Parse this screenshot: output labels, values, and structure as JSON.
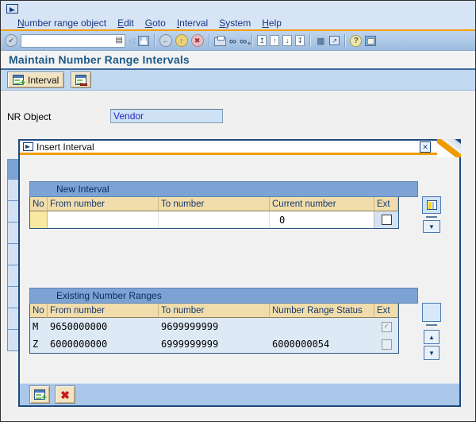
{
  "window": {
    "app_icon": "sap-logo-icon"
  },
  "menu": {
    "items": [
      "Number range object",
      "Edit",
      "Goto",
      "Interval",
      "System",
      "Help"
    ]
  },
  "toolbar": {
    "command_field": {
      "value": "",
      "placeholder": ""
    },
    "icons": {
      "enter": "✔",
      "collapse": "◁",
      "back_circle": "←",
      "exit_circle": "↑",
      "cancel_circle": "✖",
      "find": "∞",
      "find_next": "∞",
      "first_page": "↥",
      "prev_page": "↑",
      "next_page": "↓",
      "last_page": "↧",
      "new_session": "▦",
      "shortcut": "↗",
      "help": "?"
    }
  },
  "header": {
    "title": "Maintain Number Range Intervals"
  },
  "app_toolbar": {
    "interval_label": "Interval"
  },
  "form": {
    "nr_object_label": "NR Object",
    "nr_object_value": "Vendor"
  },
  "dialog": {
    "title": "Insert Interval",
    "close": "✕",
    "new_interval": {
      "section_title": "New Interval",
      "columns": [
        "No",
        "From number",
        "To number",
        "Current number",
        "Ext"
      ],
      "row": {
        "no": "",
        "from": "",
        "to": "",
        "current": "0",
        "ext": false
      }
    },
    "existing": {
      "section_title": "Existing Number Ranges",
      "columns": [
        "No",
        "From number",
        "To number",
        "Number Range Status",
        "Ext"
      ],
      "rows": [
        {
          "no": "M",
          "from": "9650000000",
          "to": "9699999999",
          "status": "",
          "ext": true
        },
        {
          "no": "Z",
          "from": "6000000000",
          "to": "6999999999",
          "status": "6000000054",
          "ext": false
        }
      ]
    },
    "scroll": {
      "up": "▲",
      "down": "▼",
      "dropdown": "▼"
    }
  },
  "colors": {
    "accent_orange": "#f59d00",
    "dialog_border": "#1b4a7d",
    "group_band": "#7ca3d3",
    "header_cell": "#f1ddab",
    "required_cell": "#f9e8a0",
    "row_bg": "#dde9f5"
  }
}
